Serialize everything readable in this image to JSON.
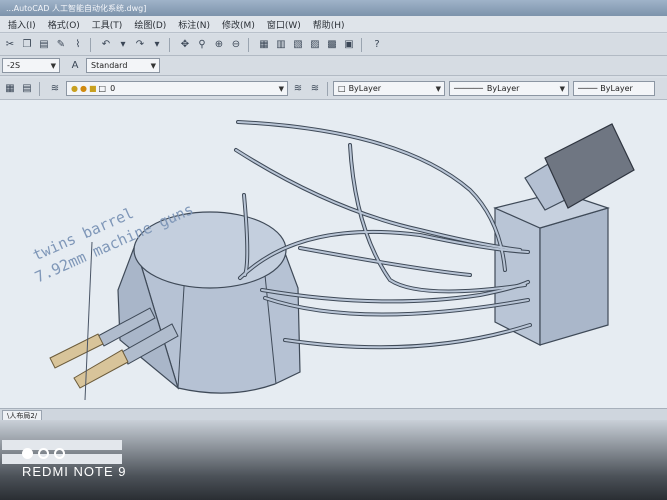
{
  "window": {
    "title": "...AutoCAD 人工智能自动化系统.dwg]"
  },
  "menu": [
    "插入(I)",
    "格式(O)",
    "工具(T)",
    "绘图(D)",
    "标注(N)",
    "修改(M)",
    "窗口(W)",
    "帮助(H)"
  ],
  "toolbar2": {
    "style_value": "-2S",
    "text_style_value": "Standard"
  },
  "toolbar3": {
    "layer_value": "0",
    "color_value": "ByLayer",
    "linetype_value": "ByLayer",
    "lineweight_value": "ByLayer"
  },
  "drawing": {
    "annotation_line1": "twins barrel",
    "annotation_line2": "7.92mm machine guns"
  },
  "tabs": {
    "layout_tab": "\\人布局2/"
  },
  "watermark": {
    "text": "REDMI NOTE 9"
  },
  "colors": {
    "model_fill": "#b9c5d6",
    "model_stroke": "#3f4a58",
    "barrel_tip": "#d8c49a",
    "annotation": "#7f97b8"
  }
}
